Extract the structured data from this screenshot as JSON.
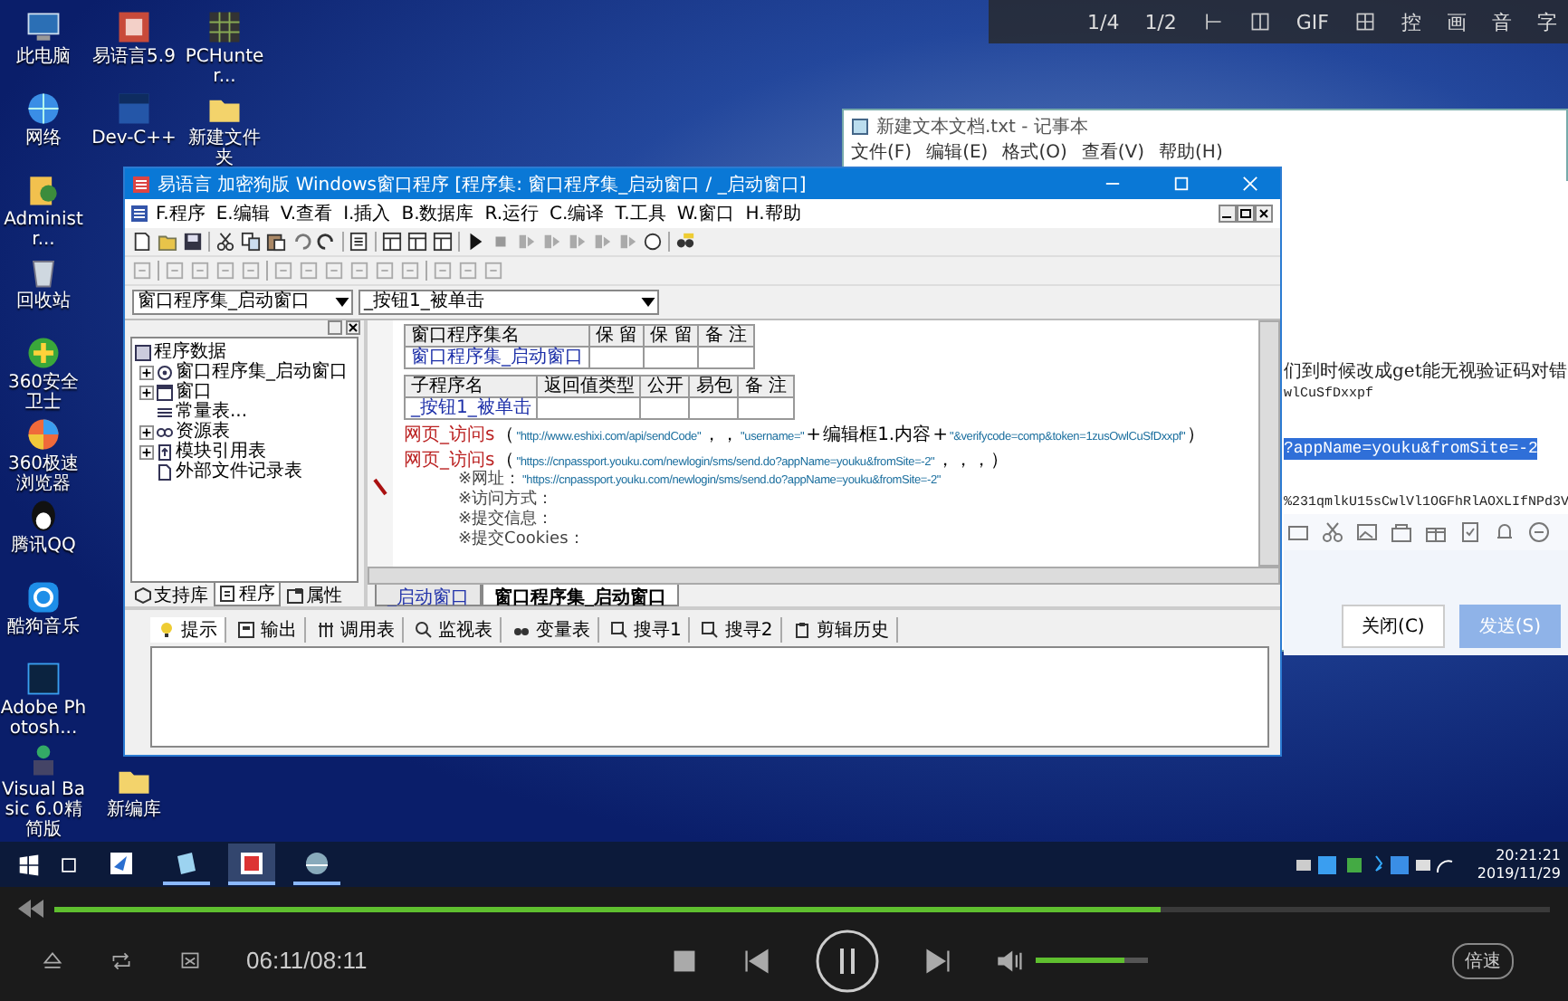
{
  "player_top": [
    {
      "kind": "text",
      "text": "1/4"
    },
    {
      "kind": "text",
      "text": "1/2"
    },
    {
      "kind": "pin"
    },
    {
      "kind": "window"
    },
    {
      "kind": "text",
      "text": "GIF"
    },
    {
      "kind": "screenshot"
    },
    {
      "kind": "text",
      "text": "控"
    },
    {
      "kind": "text",
      "text": "画"
    },
    {
      "kind": "text",
      "text": "音"
    },
    {
      "kind": "text",
      "text": "字"
    }
  ],
  "desktop": {
    "column_1": [
      {
        "label": "此电脑",
        "kind": "computer"
      },
      {
        "label": "网络",
        "kind": "network"
      },
      {
        "label": "Administr...",
        "kind": "user"
      },
      {
        "label": "回收站",
        "kind": "recycle"
      },
      {
        "label": "360安全卫士",
        "kind": "shield"
      },
      {
        "label": "360极速浏览器",
        "kind": "browser"
      },
      {
        "label": "腾讯QQ",
        "kind": "qq"
      },
      {
        "label": "酷狗音乐",
        "kind": "music"
      },
      {
        "label": "Adobe Photosh...",
        "kind": "photoshop"
      },
      {
        "label": "Visual Basic 6.0精简版",
        "kind": "vb"
      }
    ],
    "column_2": [
      {
        "label": "易语言5.9",
        "kind": "app"
      },
      {
        "label": "Dev-C++",
        "kind": "devcpp"
      },
      {
        "label": "新编库",
        "kind": "folder"
      }
    ],
    "column_3": [
      {
        "label": "PCHunter...",
        "kind": "hunter"
      },
      {
        "label": "新建文件夹",
        "kind": "folder"
      }
    ]
  },
  "notepad": {
    "title": "新建文本文档.txt - 记事本",
    "menu": [
      "文件(F)",
      "编辑(E)",
      "格式(O)",
      "查看(V)",
      "帮助(H)"
    ]
  },
  "chat": {
    "messages": [
      {
        "lines": [
          {
            "text": "们到时候改成get能无视验证码对错",
            "selected": false
          },
          {
            "text": "wlCuSfDxxpf",
            "selected": false
          }
        ]
      },
      {
        "lines": [
          {
            "text": "?appName=youku&fromSite=-2",
            "selected": true
          }
        ]
      },
      {
        "lines": [
          {
            "text": "%231qmlkU15sCwlVl1OGFhRlAOXLIfNPd3V",
            "selected": false
          }
        ]
      }
    ],
    "buttons": [
      {
        "label": "关闭(C)",
        "kind": "plain"
      },
      {
        "label": "发送(S)",
        "kind": "primary"
      }
    ]
  },
  "ide": {
    "title": "易语言 加密狗版  Windows窗口程序  [程序集: 窗口程序集_启动窗口 / _启动窗口]",
    "menu": [
      "F.程序",
      "E.编辑",
      "V.查看",
      "I.插入",
      "B.数据库",
      "R.运行",
      "C.编译",
      "T.工具",
      "W.窗口",
      "H.帮助"
    ],
    "class_combo": "窗口程序集_启动窗口",
    "method_combo": "_按钮1_被单击",
    "tree": {
      "root": "程序数据",
      "items": [
        {
          "label": "窗口程序集_启动窗口",
          "kind": "class",
          "has_children": true,
          "expanded": false
        },
        {
          "label": "窗口",
          "kind": "window",
          "has_children": true,
          "expanded": false
        },
        {
          "label": "常量表...",
          "kind": "constants",
          "has_children": false,
          "expanded": false
        },
        {
          "label": "资源表",
          "kind": "resources",
          "has_children": true,
          "expanded": false
        },
        {
          "label": "模块引用表",
          "kind": "module",
          "has_children": true,
          "expanded": false
        },
        {
          "label": "外部文件记录表",
          "kind": "file",
          "has_children": false,
          "expanded": false
        }
      ]
    },
    "panel_tabs": [
      {
        "label": "支持库",
        "kind": "library",
        "selected": false
      },
      {
        "label": "程序",
        "kind": "program",
        "selected": true
      },
      {
        "label": "属性",
        "kind": "properties",
        "selected": false
      }
    ],
    "class_table": {
      "columns": [
        "窗口程序集名",
        "保 留",
        "保 留",
        "备 注"
      ],
      "name": "窗口程序集_启动窗口"
    },
    "sub_table": {
      "columns": [
        "子程序名",
        "返回值类型",
        "公开",
        "易包",
        "备 注"
      ],
      "name": "_按钮1_被单击"
    },
    "code_lines": [
      {
        "kind": "call",
        "tokens": [
          {
            "kind": "func",
            "text": "网页_访问s"
          },
          {
            "kind": "punct",
            "text": "（"
          },
          {
            "kind": "string",
            "text": "\"http://www.eshixi.com/api/sendCode\""
          },
          {
            "kind": "punct",
            "text": "，，"
          },
          {
            "kind": "string",
            "text": "\"username=\""
          },
          {
            "kind": "punct",
            "text": "+"
          },
          {
            "kind": "name",
            "text": "编辑框1.内容"
          },
          {
            "kind": "punct",
            "text": "+"
          },
          {
            "kind": "string",
            "text": "\"&verifycode=comp&token=1zusOwlCuSfDxxpf\""
          },
          {
            "kind": "punct",
            "text": "）"
          }
        ]
      },
      {
        "kind": "call",
        "tokens": [
          {
            "kind": "func",
            "text": "网页_访问s"
          },
          {
            "kind": "punct",
            "text": "（"
          },
          {
            "kind": "string",
            "text": "\"https://cnpassport.youku.com/newlogin/sms/send.do?appName=youku&fromSite=-2\""
          },
          {
            "kind": "punct",
            "text": "，，，）"
          }
        ]
      },
      {
        "kind": "param",
        "tokens": [
          {
            "kind": "label",
            "text": "※网址："
          },
          {
            "kind": "string",
            "text": "\"https://cnpassport.youku.com/newlogin/sms/send.do?appName=youku&fromSite=-2\""
          }
        ]
      },
      {
        "kind": "param",
        "tokens": [
          {
            "kind": "label",
            "text": "※访问方式："
          }
        ]
      },
      {
        "kind": "param",
        "tokens": [
          {
            "kind": "label",
            "text": "※提交信息："
          }
        ]
      },
      {
        "kind": "param",
        "tokens": [
          {
            "kind": "label",
            "text": "※提交Cookies："
          }
        ]
      }
    ],
    "editor_tabs": [
      {
        "label": "_启动窗口",
        "selected": false
      },
      {
        "label": "窗口程序集_启动窗口",
        "selected": true
      }
    ],
    "output_tabs": [
      {
        "label": "提示",
        "kind": "hint",
        "selected": true
      },
      {
        "label": "输出",
        "kind": "output",
        "selected": false
      },
      {
        "label": "调用表",
        "kind": "calls",
        "selected": false
      },
      {
        "label": "监视表",
        "kind": "watch",
        "selected": false
      },
      {
        "label": "变量表",
        "kind": "vars",
        "selected": false
      },
      {
        "label": "搜寻1",
        "kind": "search",
        "selected": false
      },
      {
        "label": "搜寻2",
        "kind": "search",
        "selected": false
      },
      {
        "label": "剪辑历史",
        "kind": "clip",
        "selected": false
      }
    ]
  },
  "taskbar": {
    "apps": [
      {
        "kind": "bird",
        "running": false,
        "selected": false
      },
      {
        "kind": "notes",
        "running": true,
        "selected": false
      },
      {
        "kind": "red-app",
        "running": true,
        "selected": true
      },
      {
        "kind": "globe",
        "running": true,
        "selected": false
      }
    ],
    "time": "20:21:21",
    "date": "2019/11/29"
  },
  "player": {
    "progress": {
      "level": 0.74
    },
    "time": "06:11/08:11",
    "volume": {
      "level": 0.78
    },
    "speed": "倍速"
  }
}
